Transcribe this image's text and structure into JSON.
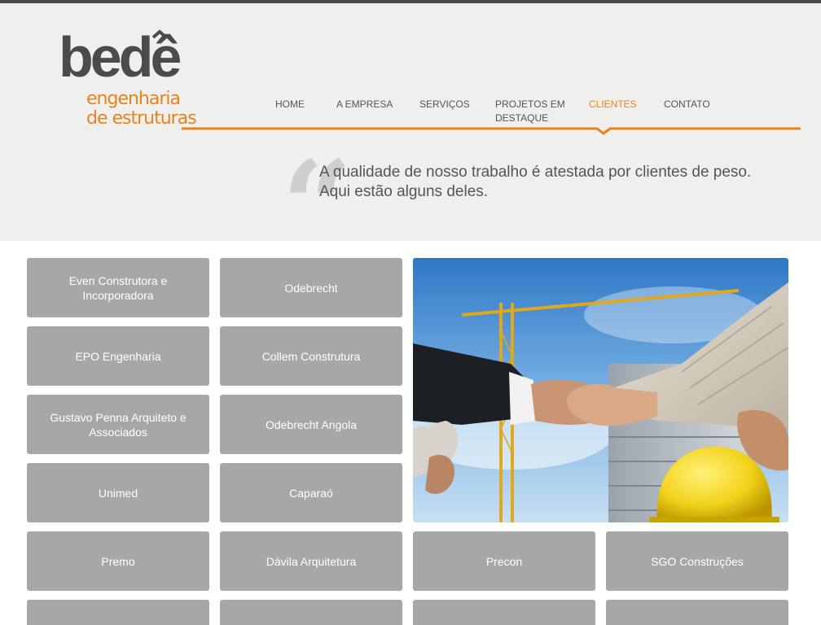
{
  "logo": {
    "word": "bedê",
    "line1": "engenharia",
    "line2": "de estruturas"
  },
  "nav": [
    {
      "label": "HOME",
      "active": false
    },
    {
      "label": "A EMPRESA",
      "active": false
    },
    {
      "label": "SERVIÇOS",
      "active": false
    },
    {
      "label": "PROJETOS EM DESTAQUE",
      "active": false
    },
    {
      "label": "CLIENTES",
      "active": true
    },
    {
      "label": "CONTATO",
      "active": false
    }
  ],
  "intro": {
    "line1": "A qualidade de nosso trabalho é atestada por clientes de peso.",
    "line2": "Aqui estão alguns deles."
  },
  "clients": [
    "Even Construtora e Incorporadora",
    "Odebrecht",
    "EPO Engenharia",
    "Collem Construtura",
    "Gustavo Penna Arquiteto e Associados",
    "Odebrecht Angola",
    "Unimed",
    "Caparaó",
    "Premo",
    "Dávila Arquitetura",
    "Precon",
    "SGO Construções"
  ],
  "colors": {
    "accent": "#e8821e",
    "tile": "#a7a7a7",
    "header_bg": "#efefee",
    "text": "#555555"
  }
}
